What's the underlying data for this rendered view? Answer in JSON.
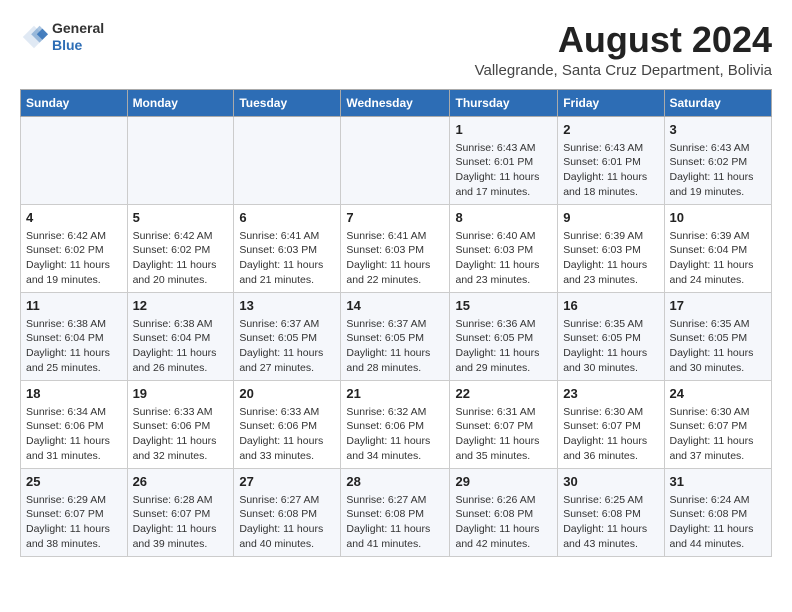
{
  "logo": {
    "general": "General",
    "blue": "Blue"
  },
  "title": {
    "month_year": "August 2024",
    "location": "Vallegrande, Santa Cruz Department, Bolivia"
  },
  "days_of_week": [
    "Sunday",
    "Monday",
    "Tuesday",
    "Wednesday",
    "Thursday",
    "Friday",
    "Saturday"
  ],
  "weeks": [
    [
      {
        "day": "",
        "info": ""
      },
      {
        "day": "",
        "info": ""
      },
      {
        "day": "",
        "info": ""
      },
      {
        "day": "",
        "info": ""
      },
      {
        "day": "1",
        "info": "Sunrise: 6:43 AM\nSunset: 6:01 PM\nDaylight: 11 hours and 17 minutes."
      },
      {
        "day": "2",
        "info": "Sunrise: 6:43 AM\nSunset: 6:01 PM\nDaylight: 11 hours and 18 minutes."
      },
      {
        "day": "3",
        "info": "Sunrise: 6:43 AM\nSunset: 6:02 PM\nDaylight: 11 hours and 19 minutes."
      }
    ],
    [
      {
        "day": "4",
        "info": "Sunrise: 6:42 AM\nSunset: 6:02 PM\nDaylight: 11 hours and 19 minutes."
      },
      {
        "day": "5",
        "info": "Sunrise: 6:42 AM\nSunset: 6:02 PM\nDaylight: 11 hours and 20 minutes."
      },
      {
        "day": "6",
        "info": "Sunrise: 6:41 AM\nSunset: 6:03 PM\nDaylight: 11 hours and 21 minutes."
      },
      {
        "day": "7",
        "info": "Sunrise: 6:41 AM\nSunset: 6:03 PM\nDaylight: 11 hours and 22 minutes."
      },
      {
        "day": "8",
        "info": "Sunrise: 6:40 AM\nSunset: 6:03 PM\nDaylight: 11 hours and 23 minutes."
      },
      {
        "day": "9",
        "info": "Sunrise: 6:39 AM\nSunset: 6:03 PM\nDaylight: 11 hours and 23 minutes."
      },
      {
        "day": "10",
        "info": "Sunrise: 6:39 AM\nSunset: 6:04 PM\nDaylight: 11 hours and 24 minutes."
      }
    ],
    [
      {
        "day": "11",
        "info": "Sunrise: 6:38 AM\nSunset: 6:04 PM\nDaylight: 11 hours and 25 minutes."
      },
      {
        "day": "12",
        "info": "Sunrise: 6:38 AM\nSunset: 6:04 PM\nDaylight: 11 hours and 26 minutes."
      },
      {
        "day": "13",
        "info": "Sunrise: 6:37 AM\nSunset: 6:05 PM\nDaylight: 11 hours and 27 minutes."
      },
      {
        "day": "14",
        "info": "Sunrise: 6:37 AM\nSunset: 6:05 PM\nDaylight: 11 hours and 28 minutes."
      },
      {
        "day": "15",
        "info": "Sunrise: 6:36 AM\nSunset: 6:05 PM\nDaylight: 11 hours and 29 minutes."
      },
      {
        "day": "16",
        "info": "Sunrise: 6:35 AM\nSunset: 6:05 PM\nDaylight: 11 hours and 30 minutes."
      },
      {
        "day": "17",
        "info": "Sunrise: 6:35 AM\nSunset: 6:05 PM\nDaylight: 11 hours and 30 minutes."
      }
    ],
    [
      {
        "day": "18",
        "info": "Sunrise: 6:34 AM\nSunset: 6:06 PM\nDaylight: 11 hours and 31 minutes."
      },
      {
        "day": "19",
        "info": "Sunrise: 6:33 AM\nSunset: 6:06 PM\nDaylight: 11 hours and 32 minutes."
      },
      {
        "day": "20",
        "info": "Sunrise: 6:33 AM\nSunset: 6:06 PM\nDaylight: 11 hours and 33 minutes."
      },
      {
        "day": "21",
        "info": "Sunrise: 6:32 AM\nSunset: 6:06 PM\nDaylight: 11 hours and 34 minutes."
      },
      {
        "day": "22",
        "info": "Sunrise: 6:31 AM\nSunset: 6:07 PM\nDaylight: 11 hours and 35 minutes."
      },
      {
        "day": "23",
        "info": "Sunrise: 6:30 AM\nSunset: 6:07 PM\nDaylight: 11 hours and 36 minutes."
      },
      {
        "day": "24",
        "info": "Sunrise: 6:30 AM\nSunset: 6:07 PM\nDaylight: 11 hours and 37 minutes."
      }
    ],
    [
      {
        "day": "25",
        "info": "Sunrise: 6:29 AM\nSunset: 6:07 PM\nDaylight: 11 hours and 38 minutes."
      },
      {
        "day": "26",
        "info": "Sunrise: 6:28 AM\nSunset: 6:07 PM\nDaylight: 11 hours and 39 minutes."
      },
      {
        "day": "27",
        "info": "Sunrise: 6:27 AM\nSunset: 6:08 PM\nDaylight: 11 hours and 40 minutes."
      },
      {
        "day": "28",
        "info": "Sunrise: 6:27 AM\nSunset: 6:08 PM\nDaylight: 11 hours and 41 minutes."
      },
      {
        "day": "29",
        "info": "Sunrise: 6:26 AM\nSunset: 6:08 PM\nDaylight: 11 hours and 42 minutes."
      },
      {
        "day": "30",
        "info": "Sunrise: 6:25 AM\nSunset: 6:08 PM\nDaylight: 11 hours and 43 minutes."
      },
      {
        "day": "31",
        "info": "Sunrise: 6:24 AM\nSunset: 6:08 PM\nDaylight: 11 hours and 44 minutes."
      }
    ]
  ]
}
